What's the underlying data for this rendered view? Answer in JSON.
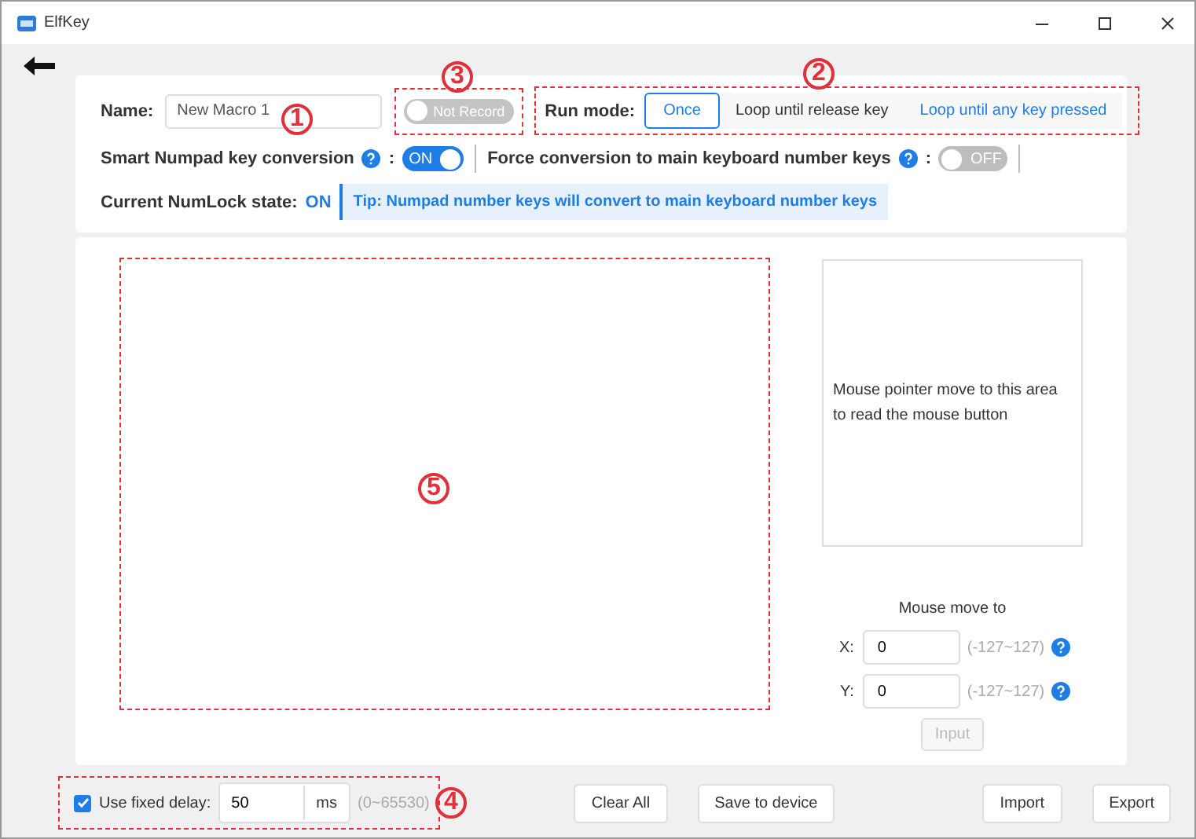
{
  "window": {
    "title": "ElfKey",
    "controls": [
      {
        "kind": "minimize"
      },
      {
        "kind": "maximize"
      },
      {
        "kind": "close"
      }
    ]
  },
  "settings": {
    "name_label": "Name:",
    "name_value": "New Macro 1",
    "record_toggle": {
      "label": "Not Record",
      "on": false
    },
    "run_mode": {
      "label": "Run mode:",
      "options": [
        {
          "label": "Once",
          "selected": true
        },
        {
          "label": "Loop until release key",
          "selected": false
        },
        {
          "label": "Loop until any key pressed",
          "selected": false
        }
      ]
    },
    "smart_numpad": {
      "label": "Smart Numpad key conversion",
      "suffix": ":",
      "toggle": {
        "label": "ON",
        "on": true
      }
    },
    "force_conversion": {
      "label": "Force conversion to main keyboard number keys",
      "suffix": ":",
      "toggle": {
        "label": "OFF",
        "on": false
      }
    },
    "numlock": {
      "label": "Current NumLock state:",
      "value": "ON"
    },
    "tip": "Tip: Numpad number keys will convert to main keyboard number keys"
  },
  "mouse_panel": {
    "area_text": "Mouse pointer move to this area to read the mouse button",
    "move_label": "Mouse move to",
    "coords": [
      {
        "label": "X:",
        "value": "0",
        "range": "(-127~127)"
      },
      {
        "label": "Y:",
        "value": "0",
        "range": "(-127~127)"
      }
    ],
    "input_button": {
      "label": "Input",
      "disabled": true
    }
  },
  "footer": {
    "fixed_delay": {
      "checked": true,
      "label": "Use fixed delay:",
      "value": "50",
      "unit": "ms",
      "range": "(0~65530)"
    },
    "buttons": [
      "Clear All",
      "Save to device",
      "Import",
      "Export"
    ]
  },
  "annotations": [
    {
      "number": "1",
      "boxed": false
    },
    {
      "number": "2",
      "boxed": true
    },
    {
      "number": "3",
      "boxed": true
    },
    {
      "number": "4",
      "boxed": true
    },
    {
      "number": "5",
      "boxed": true
    }
  ]
}
